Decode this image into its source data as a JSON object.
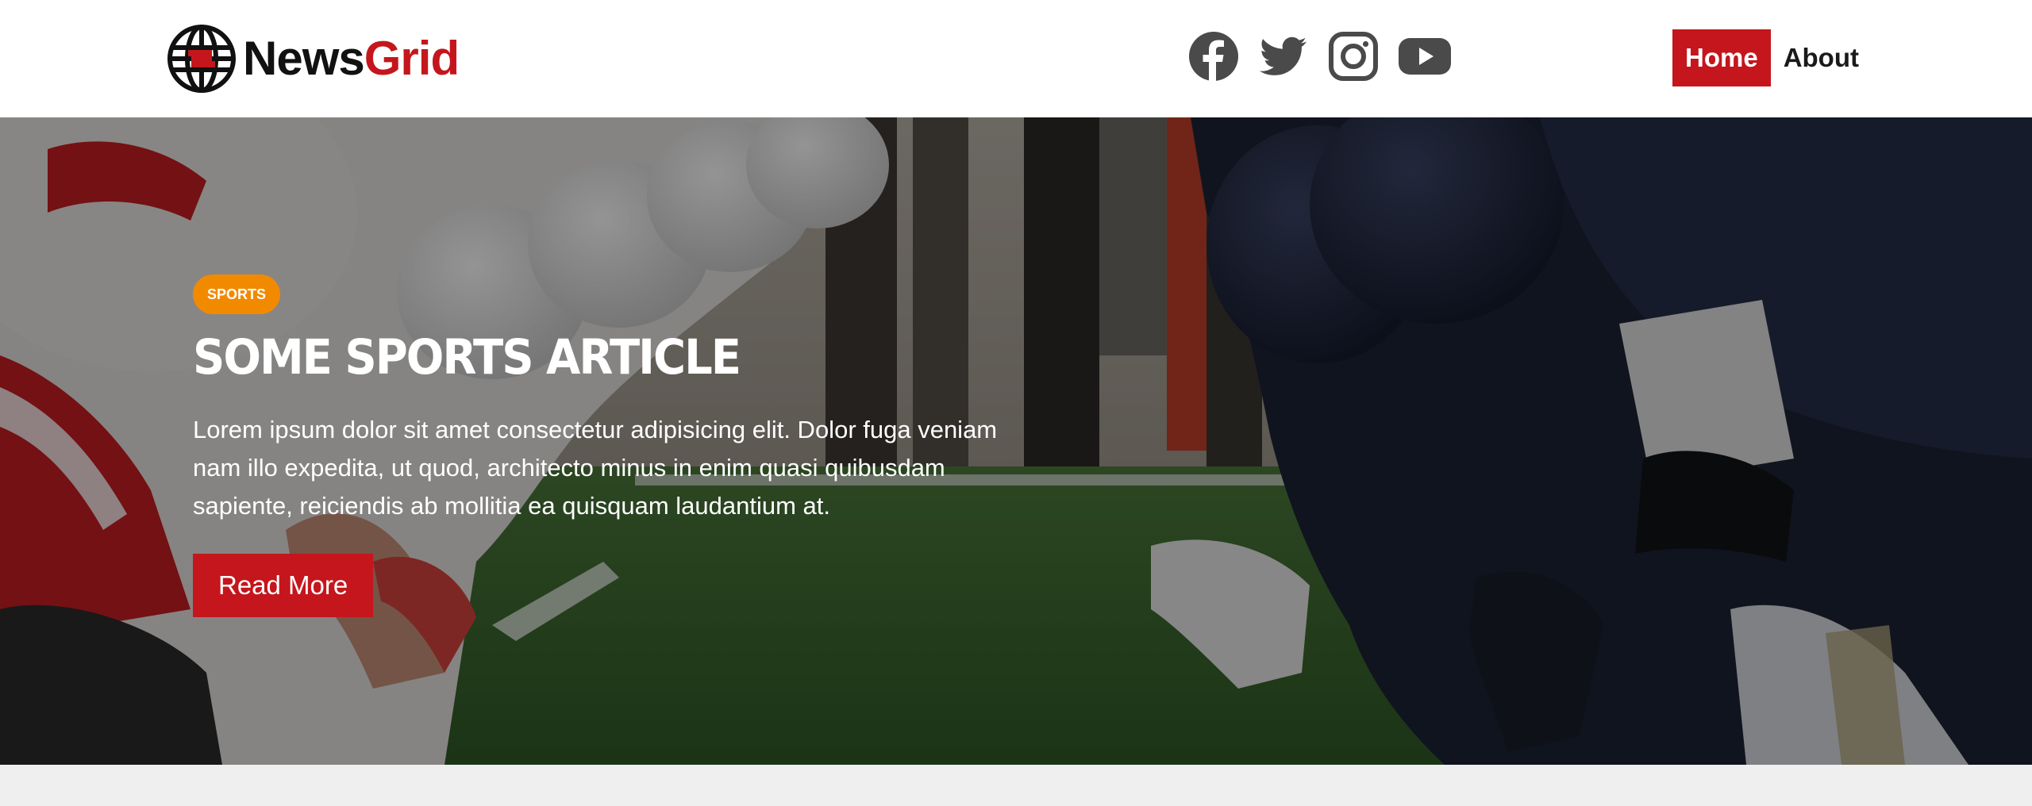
{
  "brand": {
    "name_part1": "News",
    "name_part2": "Grid",
    "logo_icon": "globe-icon",
    "accent": "#c4161c",
    "text_color": "#111111"
  },
  "social": [
    {
      "name": "facebook",
      "icon": "facebook-icon"
    },
    {
      "name": "twitter",
      "icon": "twitter-icon"
    },
    {
      "name": "instagram",
      "icon": "instagram-icon"
    },
    {
      "name": "youtube",
      "icon": "youtube-icon"
    }
  ],
  "nav": {
    "home": "Home",
    "about": "About",
    "active": "Home"
  },
  "hero": {
    "category": "Sports",
    "category_color": "#f28a00",
    "title": "Some Sports Article",
    "text": "Lorem ipsum dolor sit amet consectetur adipisicing elit. Dolor fuga veniam nam illo expedita, ut quod, architecto minus in enim quasi quibusdam sapiente, reiciendis ab mollitia ea quisquam laudantium at.",
    "button": "Read More",
    "background": "american-football-line-of-scrimmage-photo"
  }
}
